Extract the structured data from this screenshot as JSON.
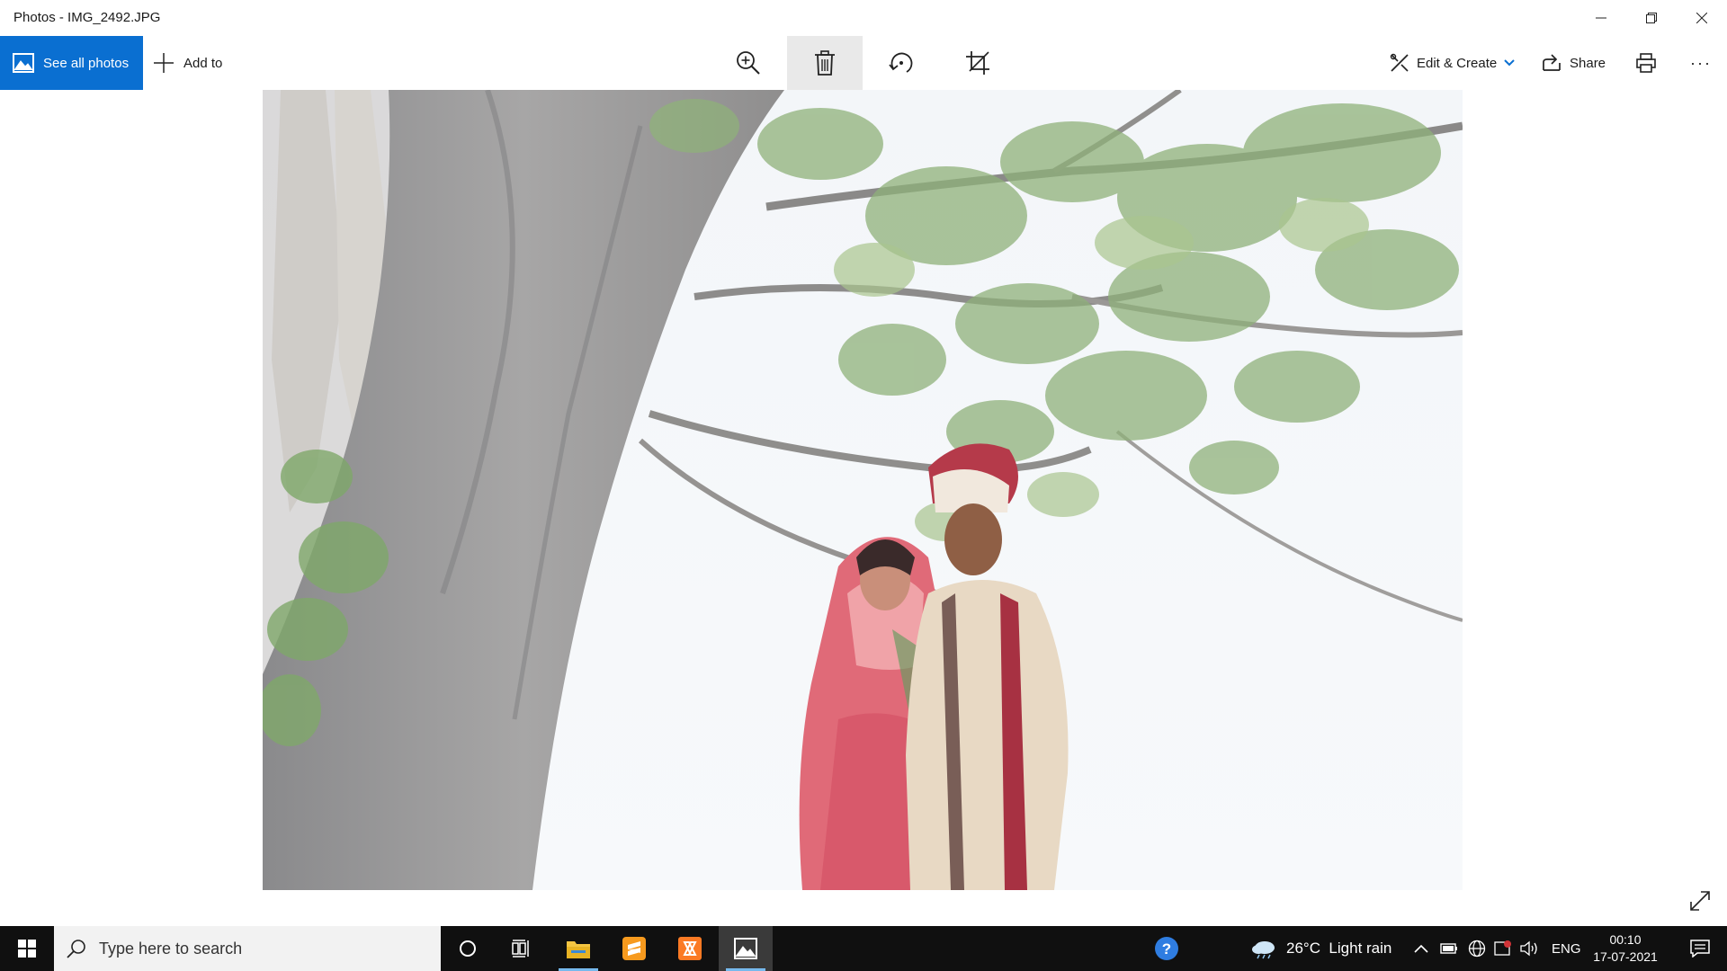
{
  "window": {
    "title": "Photos - IMG_2492.JPG",
    "controls": [
      "minimize-icon",
      "restore-icon",
      "close-icon"
    ]
  },
  "toolbar": {
    "see_all_label": "See all photos",
    "add_to_label": "Add to",
    "tools": [
      "zoom-icon",
      "delete-icon",
      "rotate-icon",
      "crop-icon"
    ],
    "edit_create_label": "Edit & Create",
    "share_label": "Share",
    "more_label": "···"
  },
  "taskbar": {
    "search_placeholder": "Type here to search",
    "weather": "26°C  Light rain",
    "language": "ENG",
    "time": "00:10",
    "date": "17-07-2021"
  },
  "colors": {
    "accent": "#0a6fd1",
    "taskbar_bg": "#101010",
    "sky": "#eef3f6",
    "trunk": "#8e8f90",
    "leaves": "#8fb17a",
    "bride_red": "#e06a78",
    "groom_cream": "#e8d9c4"
  }
}
